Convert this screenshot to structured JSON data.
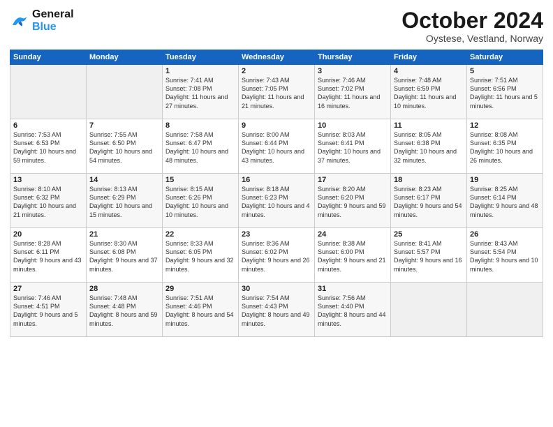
{
  "header": {
    "logo_line1": "General",
    "logo_line2": "Blue",
    "month": "October 2024",
    "location": "Oystese, Vestland, Norway"
  },
  "weekdays": [
    "Sunday",
    "Monday",
    "Tuesday",
    "Wednesday",
    "Thursday",
    "Friday",
    "Saturday"
  ],
  "weeks": [
    [
      {
        "day": "",
        "empty": true
      },
      {
        "day": "",
        "empty": true
      },
      {
        "day": "1",
        "sunrise": "Sunrise: 7:41 AM",
        "sunset": "Sunset: 7:08 PM",
        "daylight": "Daylight: 11 hours and 27 minutes."
      },
      {
        "day": "2",
        "sunrise": "Sunrise: 7:43 AM",
        "sunset": "Sunset: 7:05 PM",
        "daylight": "Daylight: 11 hours and 21 minutes."
      },
      {
        "day": "3",
        "sunrise": "Sunrise: 7:46 AM",
        "sunset": "Sunset: 7:02 PM",
        "daylight": "Daylight: 11 hours and 16 minutes."
      },
      {
        "day": "4",
        "sunrise": "Sunrise: 7:48 AM",
        "sunset": "Sunset: 6:59 PM",
        "daylight": "Daylight: 11 hours and 10 minutes."
      },
      {
        "day": "5",
        "sunrise": "Sunrise: 7:51 AM",
        "sunset": "Sunset: 6:56 PM",
        "daylight": "Daylight: 11 hours and 5 minutes."
      }
    ],
    [
      {
        "day": "6",
        "sunrise": "Sunrise: 7:53 AM",
        "sunset": "Sunset: 6:53 PM",
        "daylight": "Daylight: 10 hours and 59 minutes."
      },
      {
        "day": "7",
        "sunrise": "Sunrise: 7:55 AM",
        "sunset": "Sunset: 6:50 PM",
        "daylight": "Daylight: 10 hours and 54 minutes."
      },
      {
        "day": "8",
        "sunrise": "Sunrise: 7:58 AM",
        "sunset": "Sunset: 6:47 PM",
        "daylight": "Daylight: 10 hours and 48 minutes."
      },
      {
        "day": "9",
        "sunrise": "Sunrise: 8:00 AM",
        "sunset": "Sunset: 6:44 PM",
        "daylight": "Daylight: 10 hours and 43 minutes."
      },
      {
        "day": "10",
        "sunrise": "Sunrise: 8:03 AM",
        "sunset": "Sunset: 6:41 PM",
        "daylight": "Daylight: 10 hours and 37 minutes."
      },
      {
        "day": "11",
        "sunrise": "Sunrise: 8:05 AM",
        "sunset": "Sunset: 6:38 PM",
        "daylight": "Daylight: 10 hours and 32 minutes."
      },
      {
        "day": "12",
        "sunrise": "Sunrise: 8:08 AM",
        "sunset": "Sunset: 6:35 PM",
        "daylight": "Daylight: 10 hours and 26 minutes."
      }
    ],
    [
      {
        "day": "13",
        "sunrise": "Sunrise: 8:10 AM",
        "sunset": "Sunset: 6:32 PM",
        "daylight": "Daylight: 10 hours and 21 minutes."
      },
      {
        "day": "14",
        "sunrise": "Sunrise: 8:13 AM",
        "sunset": "Sunset: 6:29 PM",
        "daylight": "Daylight: 10 hours and 15 minutes."
      },
      {
        "day": "15",
        "sunrise": "Sunrise: 8:15 AM",
        "sunset": "Sunset: 6:26 PM",
        "daylight": "Daylight: 10 hours and 10 minutes."
      },
      {
        "day": "16",
        "sunrise": "Sunrise: 8:18 AM",
        "sunset": "Sunset: 6:23 PM",
        "daylight": "Daylight: 10 hours and 4 minutes."
      },
      {
        "day": "17",
        "sunrise": "Sunrise: 8:20 AM",
        "sunset": "Sunset: 6:20 PM",
        "daylight": "Daylight: 9 hours and 59 minutes."
      },
      {
        "day": "18",
        "sunrise": "Sunrise: 8:23 AM",
        "sunset": "Sunset: 6:17 PM",
        "daylight": "Daylight: 9 hours and 54 minutes."
      },
      {
        "day": "19",
        "sunrise": "Sunrise: 8:25 AM",
        "sunset": "Sunset: 6:14 PM",
        "daylight": "Daylight: 9 hours and 48 minutes."
      }
    ],
    [
      {
        "day": "20",
        "sunrise": "Sunrise: 8:28 AM",
        "sunset": "Sunset: 6:11 PM",
        "daylight": "Daylight: 9 hours and 43 minutes."
      },
      {
        "day": "21",
        "sunrise": "Sunrise: 8:30 AM",
        "sunset": "Sunset: 6:08 PM",
        "daylight": "Daylight: 9 hours and 37 minutes."
      },
      {
        "day": "22",
        "sunrise": "Sunrise: 8:33 AM",
        "sunset": "Sunset: 6:05 PM",
        "daylight": "Daylight: 9 hours and 32 minutes."
      },
      {
        "day": "23",
        "sunrise": "Sunrise: 8:36 AM",
        "sunset": "Sunset: 6:02 PM",
        "daylight": "Daylight: 9 hours and 26 minutes."
      },
      {
        "day": "24",
        "sunrise": "Sunrise: 8:38 AM",
        "sunset": "Sunset: 6:00 PM",
        "daylight": "Daylight: 9 hours and 21 minutes."
      },
      {
        "day": "25",
        "sunrise": "Sunrise: 8:41 AM",
        "sunset": "Sunset: 5:57 PM",
        "daylight": "Daylight: 9 hours and 16 minutes."
      },
      {
        "day": "26",
        "sunrise": "Sunrise: 8:43 AM",
        "sunset": "Sunset: 5:54 PM",
        "daylight": "Daylight: 9 hours and 10 minutes."
      }
    ],
    [
      {
        "day": "27",
        "sunrise": "Sunrise: 7:46 AM",
        "sunset": "Sunset: 4:51 PM",
        "daylight": "Daylight: 9 hours and 5 minutes."
      },
      {
        "day": "28",
        "sunrise": "Sunrise: 7:48 AM",
        "sunset": "Sunset: 4:48 PM",
        "daylight": "Daylight: 8 hours and 59 minutes."
      },
      {
        "day": "29",
        "sunrise": "Sunrise: 7:51 AM",
        "sunset": "Sunset: 4:46 PM",
        "daylight": "Daylight: 8 hours and 54 minutes."
      },
      {
        "day": "30",
        "sunrise": "Sunrise: 7:54 AM",
        "sunset": "Sunset: 4:43 PM",
        "daylight": "Daylight: 8 hours and 49 minutes."
      },
      {
        "day": "31",
        "sunrise": "Sunrise: 7:56 AM",
        "sunset": "Sunset: 4:40 PM",
        "daylight": "Daylight: 8 hours and 44 minutes."
      },
      {
        "day": "",
        "empty": true
      },
      {
        "day": "",
        "empty": true
      }
    ]
  ]
}
